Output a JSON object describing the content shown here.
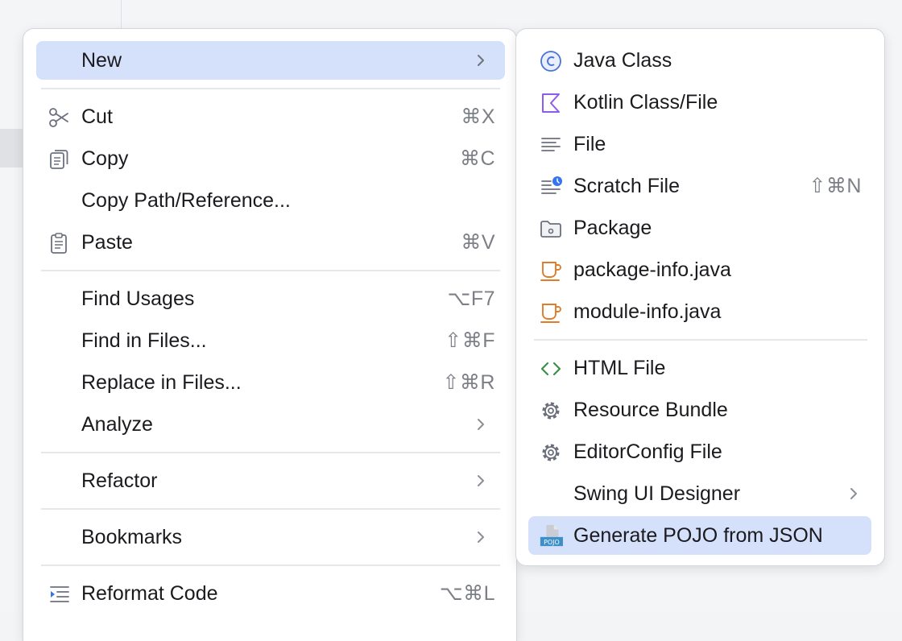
{
  "main_menu": {
    "items": [
      {
        "label": "New"
      },
      {
        "label": "Cut",
        "shortcut": "⌘X"
      },
      {
        "label": "Copy",
        "shortcut": "⌘C"
      },
      {
        "label": "Copy Path/Reference..."
      },
      {
        "label": "Paste",
        "shortcut": "⌘V"
      },
      {
        "label": "Find Usages",
        "shortcut": "⌥F7"
      },
      {
        "label": "Find in Files...",
        "shortcut": "⇧⌘F"
      },
      {
        "label": "Replace in Files...",
        "shortcut": "⇧⌘R"
      },
      {
        "label": "Analyze"
      },
      {
        "label": "Refactor"
      },
      {
        "label": "Bookmarks"
      },
      {
        "label": "Reformat Code",
        "shortcut": "⌥⌘L"
      }
    ]
  },
  "sub_menu": {
    "items": [
      {
        "label": "Java Class"
      },
      {
        "label": "Kotlin Class/File"
      },
      {
        "label": "File"
      },
      {
        "label": "Scratch File",
        "shortcut": "⇧⌘N"
      },
      {
        "label": "Package"
      },
      {
        "label": "package-info.java"
      },
      {
        "label": "module-info.java"
      },
      {
        "label": "HTML File"
      },
      {
        "label": "Resource Bundle"
      },
      {
        "label": "EditorConfig File"
      },
      {
        "label": "Swing UI Designer"
      },
      {
        "label": "Generate POJO from JSON",
        "icon_text": "POJO"
      }
    ]
  },
  "colors": {
    "selection": "#d5e0fa",
    "java_class_icon": "#4a72d8",
    "kotlin_icon": "#8a5cf0",
    "coffee_icon": "#e07d2a",
    "html_icon": "#3f8f4a",
    "shortcut_text": "#7c7f86"
  }
}
